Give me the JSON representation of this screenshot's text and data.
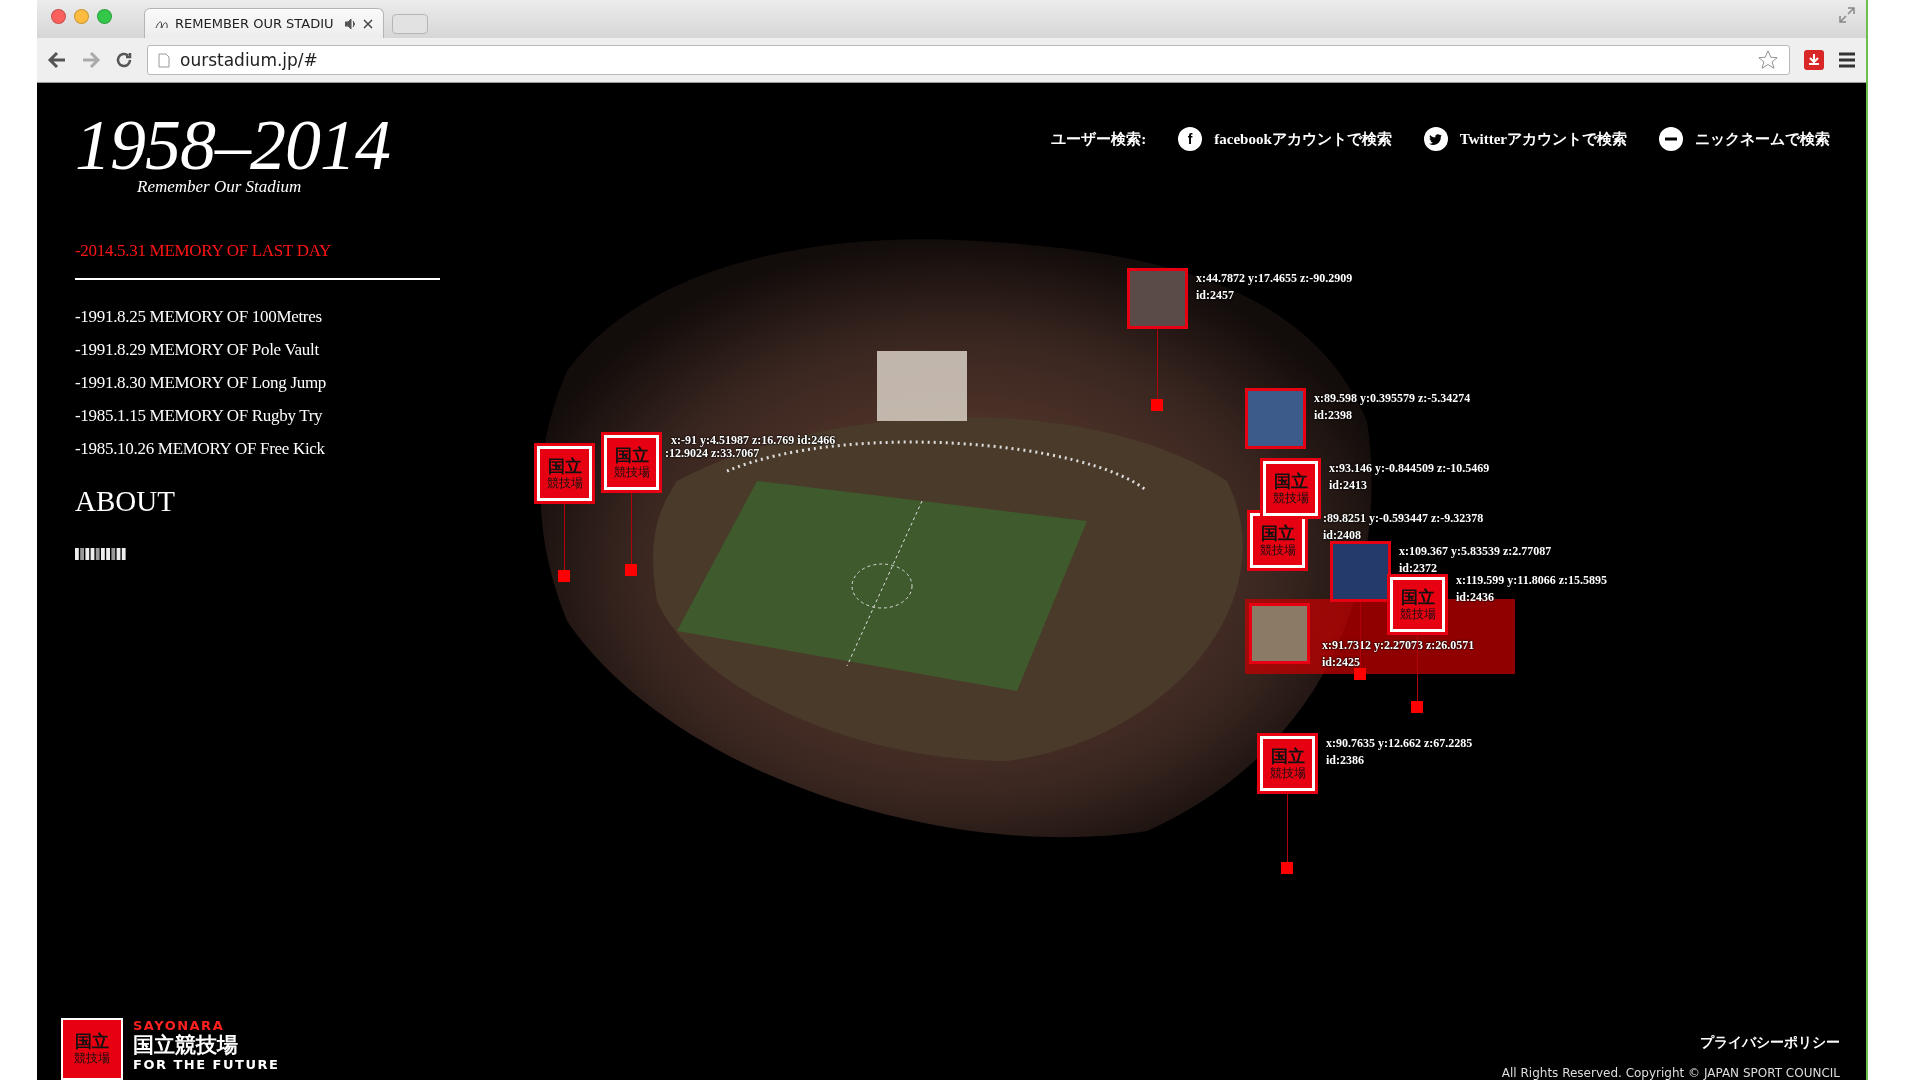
{
  "browser": {
    "tab_title": "REMEMBER OUR STADIU",
    "url": "ourstadium.jp/#"
  },
  "logo": {
    "years": "1958–2014",
    "subtitle": "Remember Our Stadium"
  },
  "menu": [
    {
      "label": "-2014.5.31 MEMORY OF LAST DAY",
      "selected": true
    },
    {
      "label": "-1991.8.25 MEMORY OF 100Metres",
      "selected": false
    },
    {
      "label": "-1991.8.29 MEMORY OF Pole Vault",
      "selected": false
    },
    {
      "label": "-1991.8.30 MEMORY OF Long Jump",
      "selected": false
    },
    {
      "label": "-1985.1.15 MEMORY OF Rugby Try",
      "selected": false
    },
    {
      "label": "-1985.10.26 MEMORY OF Free Kick",
      "selected": false
    }
  ],
  "about": "ABOUT",
  "user_search": {
    "label": "ユーザー検索:",
    "options": [
      {
        "kind": "facebook",
        "glyph": "f",
        "label": "facebookアカウントで検索"
      },
      {
        "kind": "twitter",
        "label": "Twitterアカウントで検索"
      },
      {
        "kind": "nickname",
        "label": "ニックネームで検索"
      }
    ]
  },
  "markers": [
    {
      "kind": "photo",
      "label": [
        "x:44.7872 y:17.4655 z:-90.2909",
        "id:2457"
      ],
      "highlighted": false
    },
    {
      "kind": "photo",
      "label": [
        "x:89.598 y:0.395579 z:-5.34274",
        "id:2398"
      ],
      "highlighted": false
    },
    {
      "kind": "logo",
      "badge": [
        "国立",
        "競技場"
      ],
      "label": [
        "x:-91 y:4.51987 z:16.769 id:2466"
      ],
      "highlighted": false
    },
    {
      "kind": "logo",
      "badge": [
        "国立",
        "競技場"
      ],
      "label": [
        ":12.9024 z:33.7067"
      ],
      "highlighted": false
    },
    {
      "kind": "logo",
      "badge": [
        "国立",
        "競技場"
      ],
      "label": [
        "x:93.146 y:-0.844509 z:-10.5469",
        "id:2413"
      ],
      "highlighted": false
    },
    {
      "kind": "logo",
      "badge": [
        "国立",
        "競技場"
      ],
      "label": [
        ":89.8251 y:-0.593447 z:-9.32378",
        "id:2408"
      ],
      "highlighted": false
    },
    {
      "kind": "photo",
      "label": [
        "x:109.367 y:5.83539 z:2.77087",
        "id:2372"
      ],
      "highlighted": false
    },
    {
      "kind": "logo",
      "badge": [
        "国立",
        "競技場"
      ],
      "label": [
        "x:119.599 y:11.8066 z:15.5895",
        "id:2436"
      ],
      "highlighted": false
    },
    {
      "kind": "photo",
      "label": [
        "x:91.7312 y:2.27073 z:26.0571",
        "id:2425"
      ],
      "highlighted": true
    },
    {
      "kind": "logo",
      "badge": [
        "国立",
        "競技場"
      ],
      "label": [
        "x:90.7635 y:12.662 z:67.2285",
        "id:2386"
      ],
      "highlighted": false
    }
  ],
  "footer": {
    "badge": [
      "国立",
      "競技場"
    ],
    "brand": [
      "SAYONARA",
      "国立競技場",
      "FOR THE FUTURE"
    ],
    "privacy": "プライバシーポリシー",
    "copyright": "All Rights Reserved. Copyright © JAPAN SPORT COUNCIL"
  }
}
